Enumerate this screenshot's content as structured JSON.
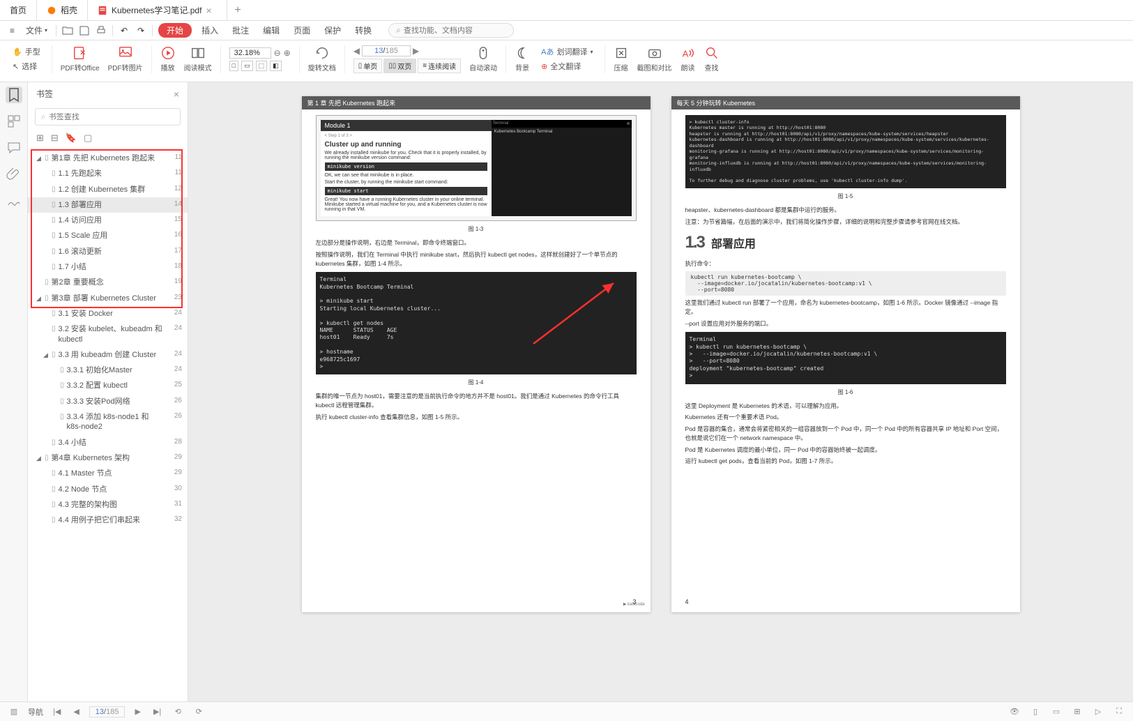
{
  "tabs": [
    {
      "label": "首页",
      "icon": "home"
    },
    {
      "label": "稻壳",
      "icon": "docer",
      "color": "#ff7a00"
    },
    {
      "label": "Kubernetes学习笔记.pdf",
      "icon": "pdf",
      "color": "#e64545",
      "active": true
    }
  ],
  "menubar": {
    "file": "文件",
    "start": "开始",
    "items": [
      "插入",
      "批注",
      "编辑",
      "页面",
      "保护",
      "转换"
    ],
    "search_placeholder": "查找功能、文档内容"
  },
  "toolbar": {
    "hand": "手型",
    "select": "选择",
    "pdf_office": "PDF转Office",
    "pdf_image": "PDF转图片",
    "play": "播放",
    "read_mode": "阅读模式",
    "zoom": "32.18%",
    "rotate": "旋转文档",
    "single": "单页",
    "double": "双页",
    "continuous": "连续阅读",
    "auto_scroll": "自动滚动",
    "bg": "背景",
    "word_trans": "划词翻译",
    "full_trans": "全文翻译",
    "compress": "压缩",
    "screenshot": "截图和对比",
    "read_aloud": "朗读",
    "find": "查找",
    "page_current": "13",
    "page_total": "185"
  },
  "sidebar": {
    "title": "书签",
    "search_placeholder": "书签查找",
    "tree": [
      {
        "depth": 0,
        "label": "第1章 先把 Kubernetes 跑起来",
        "page": "11",
        "expanded": true
      },
      {
        "depth": 1,
        "label": "1.1 先跑起来",
        "page": "11"
      },
      {
        "depth": 1,
        "label": "1.2 创建 Kubernetes 集群",
        "page": "12"
      },
      {
        "depth": 1,
        "label": "1.3 部署应用",
        "page": "14",
        "selected": true
      },
      {
        "depth": 1,
        "label": "1.4 访问应用",
        "page": "15"
      },
      {
        "depth": 1,
        "label": "1.5 Scale 应用",
        "page": "16"
      },
      {
        "depth": 1,
        "label": "1.6 滚动更新",
        "page": "17"
      },
      {
        "depth": 1,
        "label": "1.7 小结",
        "page": "18"
      },
      {
        "depth": 0,
        "label": "第2章 重要概念",
        "page": "19"
      },
      {
        "depth": 0,
        "label": "第3章 部署 Kubernetes Cluster",
        "page": "23",
        "expanded": true
      },
      {
        "depth": 1,
        "label": "3.1 安装 Docker",
        "page": "24"
      },
      {
        "depth": 1,
        "label": "3.2 安装 kubelet、kubeadm 和 kubectl",
        "page": "24"
      },
      {
        "depth": 1,
        "label": "3.3 用 kubeadm 创建 Cluster",
        "page": "24",
        "expanded": true
      },
      {
        "depth": 2,
        "label": "3.3.1 初始化Master",
        "page": "24"
      },
      {
        "depth": 2,
        "label": "3.3.2 配置 kubectl",
        "page": "25"
      },
      {
        "depth": 2,
        "label": "3.3.3 安装Pod网络",
        "page": "26"
      },
      {
        "depth": 2,
        "label": "3.3.4 添加 k8s-node1 和 k8s-node2",
        "page": "26"
      },
      {
        "depth": 1,
        "label": "3.4 小结",
        "page": "28"
      },
      {
        "depth": 0,
        "label": "第4章 Kubernetes 架构",
        "page": "29",
        "expanded": true
      },
      {
        "depth": 1,
        "label": "4.1 Master 节点",
        "page": "29"
      },
      {
        "depth": 1,
        "label": "4.2 Node 节点",
        "page": "30"
      },
      {
        "depth": 1,
        "label": "4.3 完整的架构图",
        "page": "31"
      },
      {
        "depth": 1,
        "label": "4.4 用例子把它们串起来",
        "page": "32"
      }
    ]
  },
  "page_left": {
    "header": "第 1 章  先把 Kubernetes 跑起来",
    "module_title": "Module 1",
    "module_sub": "Cluster up and running",
    "module_body1": "We already installed minikube for you. Check that it is properly installed, by running the minikube version command:",
    "module_cmd1": "minikube version",
    "module_body2": "OK, we can see that minikube is in place.",
    "module_body3": "Start the cluster, by running the minikube start command:",
    "module_cmd2": "minikube start",
    "module_body4": "Great! You now have a running Kubernetes cluster in your online terminal. Minikube started a virtual machine for you, and a Kubernetes cluster is now running in that VM.",
    "module_term_title": "Terminal",
    "module_term_sub": "Kubernetes Bootcamp Terminal",
    "module_footer": "katacoda",
    "fig1": "图 1-3",
    "p1": "左边部分是操作说明，右边是 Terminal，即命令终端窗口。",
    "p2": "按照操作说明，我们在 Terminal 中执行 minikube start，然后执行 kubectl get nodes，这样就创建好了一个单节点的 kubernetes 集群，如图 1-4 所示。",
    "term2": "Terminal\nKubernetes Bootcamp Terminal\n\n> minikube start\nStarting local Kubernetes cluster...\n\n> kubectl get nodes\nNAME      STATUS    AGE\nhost01    Ready     7s\n\n> hostname\ne968725c1697\n>",
    "fig2": "图 1-4",
    "p3": "集群的唯一节点为 host01，需要注意的是当前执行命令的地方并不是 host01。我们是通过 Kubernetes 的命令行工具 kubectl 远程管理集群。",
    "p4": "执行 kubectl cluster-info 查看集群信息，如图 1-5 所示。",
    "pgnum": "3"
  },
  "page_right": {
    "header": "每天 5 分钟玩转 Kubernetes",
    "term1": "> kubectl cluster-info\nKubernetes master is running at http://host01:8080\nheapster is running at http://host01:8080/api/v1/proxy/namespaces/kube-system/services/heapster\nkubernetes-dashboard is running at http://host01:8080/api/v1/proxy/namespaces/kube-system/services/kubernetes-dashboard\nmonitoring-grafana is running at http://host01:8080/api/v1/proxy/namespaces/kube-system/services/monitoring-grafana\nmonitoring-influxdb is running at http://host01:8080/api/v1/proxy/namespaces/kube-system/services/monitoring-influxdb\n\nTo further debug and diagnose cluster problems, use 'kubectl cluster-info dump'.",
    "fig1": "图 1-5",
    "p1": "heapster、kubernetes-dashboard 都是集群中运行的服务。",
    "p2": "注意：为节省篇幅，在后面的演示中，我们将简化操作步骤，详细的说明和完整步骤请参考官网在线文档。",
    "sec_num": "1.3",
    "sec_title": "部署应用",
    "p3": "执行命令：",
    "cmd": "kubectl run kubernetes-bootcamp \\\n  --image=docker.io/jocatalin/kubernetes-bootcamp:v1 \\\n  --port=8080",
    "p4": "这里我们通过 kubectl run 部署了一个应用，命名为 kubernetes-bootcamp，如图 1-6 所示。Docker 镜像通过 --image 指定。",
    "p5": "--port 设置应用对外服务的端口。",
    "term2": "Terminal\n> kubectl run kubernetes-bootcamp \\\n>   --image=docker.io/jocatalin/kubernetes-bootcamp:v1 \\\n>   --port=8080\ndeployment \"kubernetes-bootcamp\" created\n>",
    "fig2": "图 1-6",
    "p6": "这里 Deployment 是 Kubernetes 的术语，可以理解为应用。",
    "p7": "Kubernetes 还有一个重要术语 Pod。",
    "p8": "Pod 是容器的集合，通常会将紧密相关的一组容器放到一个 Pod 中，同一个 Pod 中的所有容器共享 IP 地址和 Port 空间，也就是说它们在一个 network namespace 中。",
    "p9": "Pod 是 Kubernetes 调度的最小单位，同一 Pod 中的容器始终被一起调度。",
    "p10": "运行 kubectl get pods，查看当前的 Pod，如图 1-7 所示。",
    "pgnum": "4"
  },
  "statusbar": {
    "nav": "导航",
    "page_current": "13",
    "page_total": "185"
  }
}
